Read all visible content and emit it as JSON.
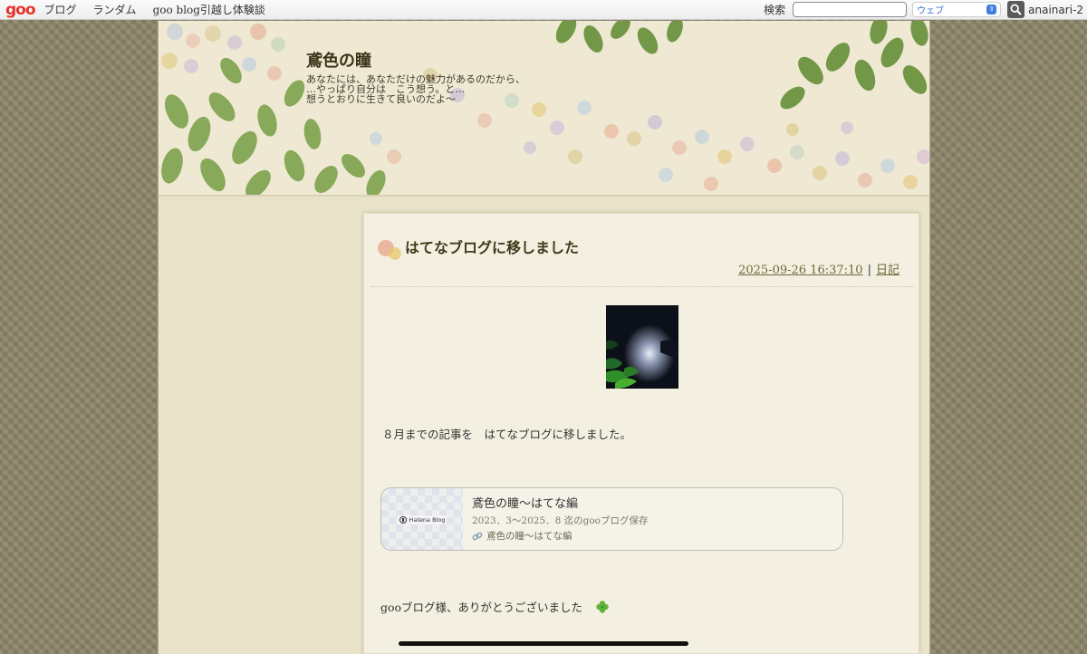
{
  "topbar": {
    "logo": "goo",
    "nav": [
      "ブログ",
      "ランダム",
      "goo blog引越し体験談"
    ],
    "search_label": "検索",
    "search_value": "",
    "search_scope": "ウェブ",
    "user": "anainari-2"
  },
  "blog": {
    "title": "鳶色の瞳",
    "description": "あなたには、あなただけの魅力があるのだから、\n…やっぱり自分は　こう想う。と…\n想うとおりに生きて良いのだよ〜"
  },
  "entry": {
    "title": "はてなブログに移しました",
    "datetime": "2025-09-26 16:37:10",
    "separator": "|",
    "category": "日記",
    "body_text": "８月までの記事を　はてなブログに移しました。",
    "card": {
      "badge": "Hatena Blog",
      "title": "鳶色の瞳〜はてな編",
      "subtitle": "2023．3〜2025．8 迄のgooブログ保存",
      "link_text": "鳶色の瞳〜はてな編"
    },
    "closing_text": "gooブログ様、ありがとうございました"
  },
  "colors": {
    "accent_red": "#e5352b",
    "page_bg": "#8b8468",
    "entry_bg": "#f4f0e1",
    "link_olive": "#6b6a3a"
  },
  "icons": [
    "search-icon",
    "chevron-updown-icon",
    "link-icon",
    "clover-icon",
    "hatena-logo-icon"
  ]
}
